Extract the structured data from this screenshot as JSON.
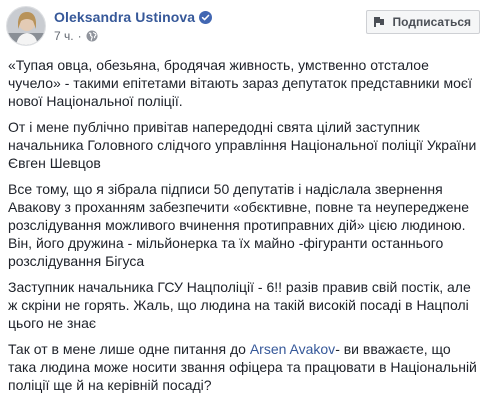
{
  "author": {
    "name": "Oleksandra Ustinova",
    "verified": true,
    "time": "7 ч.",
    "dot": "·"
  },
  "follow": {
    "label": "Подписаться"
  },
  "paragraphs": [
    {
      "text": "«Тупая овца, обезьяна, бродячая живность, умственно отсталое чучело» - такими епітетами вітають зараз депутаток представники моєї нової Національної поліції."
    },
    {
      "text": "От і мене публічно привітав напередодні свята цілий заступник начальника Головного слідчого управління Національної поліції України Євген Шевцов"
    },
    {
      "text": "Все тому, що я зібрала підписи 50 депутатів і надіслала звернення Авакову з проханням забезпечити «обєктивне, повне та неупереджене розслідування можливого вчинення протиправних дій» цією людиною. Він, його дружина - мільйонерка та їх майно -фігуранти останнього розслідування Бігуса"
    },
    {
      "text": "Заступник начальника ГСУ Нацполіції - 6!! разів правив свій постік, але ж скріни не горять. Жаль, що людина на такій високій посаді в Нацполі цього не знає"
    }
  ],
  "last_paragraph": {
    "before": "Так от в мене лише одне питання до ",
    "mention": "Arsen Avakov",
    "after": "- ви вважаєте, що така людина може носити звання офіцера та працювати в Національній поліції ще й на керівній посаді?"
  },
  "colors": {
    "link": "#365899",
    "verified": "#4267b2",
    "text": "#1d2129",
    "meta": "#616770"
  },
  "icons": {
    "verified": "verified-badge-icon",
    "audience": "globe-icon",
    "follow": "follow-icon"
  }
}
